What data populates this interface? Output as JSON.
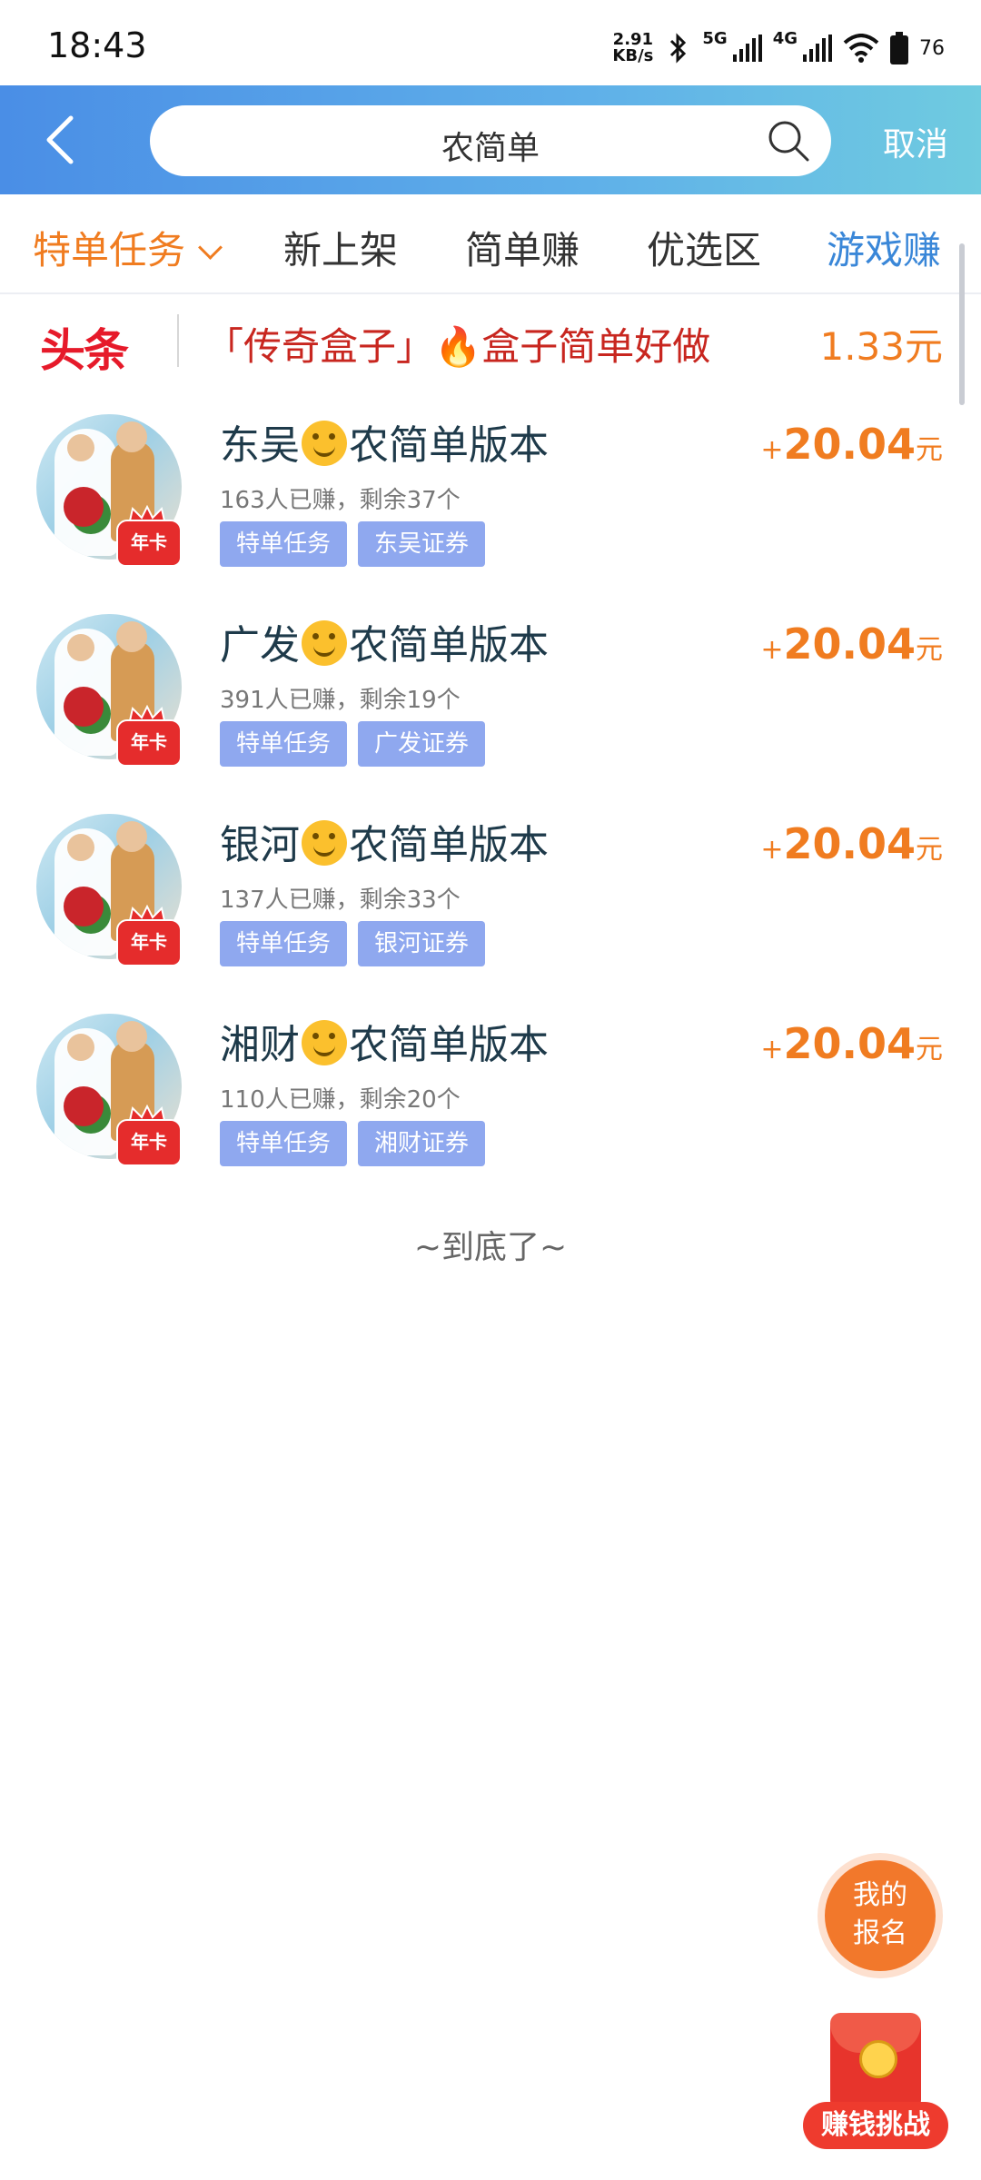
{
  "status_bar": {
    "time": "18:43",
    "net_speed_value": "2.91",
    "net_speed_unit": "KB/s",
    "signal_5g": "5G",
    "signal_4g": "4G",
    "battery": "76"
  },
  "header": {
    "search_query": "农简单",
    "cancel_label": "取消",
    "accent_color": "#4a8ee6"
  },
  "tabs": [
    {
      "label": "特单任务"
    },
    {
      "label": "新上架"
    },
    {
      "label": "简单赚"
    },
    {
      "label": "优选区"
    },
    {
      "label": "游戏赚"
    }
  ],
  "headline": {
    "logo": "头条",
    "text": "「传奇盒子」🔥盒子简单好做",
    "price": "1.33元"
  },
  "items": [
    {
      "title_prefix": "东吴",
      "title_suffix": "农简单版本",
      "stats": "163人已赚，剩余37个",
      "tag1": "特单任务",
      "tag2": "东吴证券",
      "badge": "年卡",
      "plus": "+",
      "amount": "20.04",
      "unit": "元"
    },
    {
      "title_prefix": "广发",
      "title_suffix": "农简单版本",
      "stats": "391人已赚，剩余19个",
      "tag1": "特单任务",
      "tag2": "广发证券",
      "badge": "年卡",
      "plus": "+",
      "amount": "20.04",
      "unit": "元"
    },
    {
      "title_prefix": "银河",
      "title_suffix": "农简单版本",
      "stats": "137人已赚，剩余33个",
      "tag1": "特单任务",
      "tag2": "银河证券",
      "badge": "年卡",
      "plus": "+",
      "amount": "20.04",
      "unit": "元"
    },
    {
      "title_prefix": "湘财",
      "title_suffix": "农简单版本",
      "stats": "110人已赚，剩余20个",
      "tag1": "特单任务",
      "tag2": "湘财证券",
      "badge": "年卡",
      "plus": "+",
      "amount": "20.04",
      "unit": "元"
    }
  ],
  "end_text": "~到底了~",
  "fab": {
    "line1": "我的",
    "line2": "报名"
  },
  "challenge": {
    "label": "赚钱挑战"
  },
  "colors": {
    "orange": "#f07c20",
    "tag_bg": "#8fa8ef",
    "headline_red": "#e61a2a"
  }
}
